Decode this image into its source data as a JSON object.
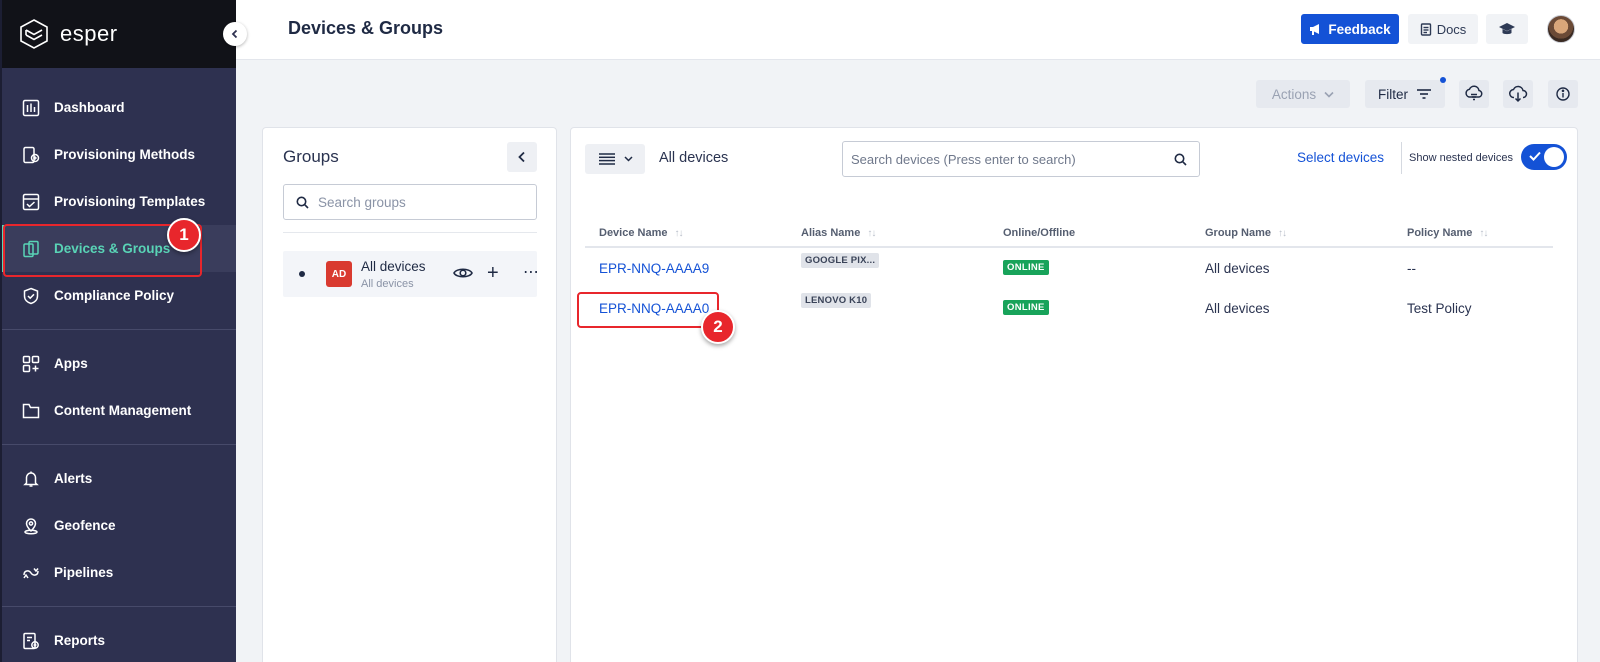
{
  "app": {
    "brand": "esper",
    "accent": "#1452d6",
    "active_nav_color": "#59d4b6",
    "annotation_color": "#e8262c"
  },
  "sidebar": {
    "items": [
      {
        "label": "Dashboard",
        "icon": "dashboard-icon"
      },
      {
        "label": "Provisioning Methods",
        "icon": "provisioning-methods-icon"
      },
      {
        "label": "Provisioning Templates",
        "icon": "provisioning-templates-icon"
      },
      {
        "label": "Devices & Groups",
        "icon": "devices-groups-icon",
        "active": true
      },
      {
        "label": "Compliance Policy",
        "icon": "shield-icon"
      },
      {
        "label": "Apps",
        "icon": "apps-icon"
      },
      {
        "label": "Content Management",
        "icon": "folder-icon"
      },
      {
        "label": "Alerts",
        "icon": "bell-icon"
      },
      {
        "label": "Geofence",
        "icon": "location-pin-icon"
      },
      {
        "label": "Pipelines",
        "icon": "pipelines-icon"
      },
      {
        "label": "Reports",
        "icon": "reports-icon"
      }
    ]
  },
  "header": {
    "title": "Devices & Groups",
    "feedback_label": "Feedback",
    "docs_label": "Docs"
  },
  "toolbar": {
    "actions_label": "Actions",
    "filter_label": "Filter"
  },
  "groups": {
    "title": "Groups",
    "search_placeholder": "Search groups",
    "items": [
      {
        "badge": "AD",
        "name": "All devices",
        "subtitle": "All devices"
      }
    ]
  },
  "devices": {
    "view_label": "All devices",
    "search_placeholder": "Search devices (Press enter to search)",
    "select_devices_label": "Select devices",
    "nested_label": "Show nested devices",
    "nested_enabled": true,
    "columns": [
      "Device Name",
      "Alias Name",
      "Online/Offline",
      "Group Name",
      "Policy Name"
    ],
    "rows": [
      {
        "device": "EPR-NNQ-AAAA9",
        "alias": "GOOGLE PIX...",
        "status": "ONLINE",
        "group": "All devices",
        "policy": "--"
      },
      {
        "device": "EPR-NNQ-AAAA0",
        "alias": "LENOVO K10",
        "status": "ONLINE",
        "group": "All devices",
        "policy": "Test Policy"
      }
    ]
  },
  "annotations": {
    "step1": "1",
    "step2": "2"
  }
}
